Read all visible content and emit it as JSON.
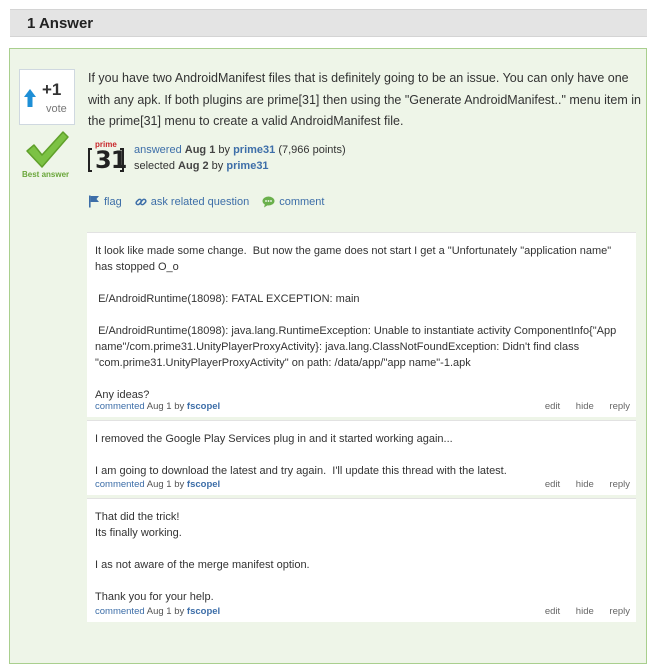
{
  "header": {
    "title": "1 Answer"
  },
  "answer": {
    "vote": {
      "count": "+1",
      "label": "vote"
    },
    "best_answer_label": "Best answer",
    "text": "If you have two AndroidManifest files that is definitely going to be an issue. You can only have one with any apk. If both plugins are prime[31] then using the \"Generate AndroidManifest..\" menu item in the prime[31] menu to create a valid AndroidManifest file.",
    "avatar": {
      "top": "prime",
      "number": "31"
    },
    "answered": {
      "label": "answered",
      "date": "Aug 1",
      "by": "by",
      "user": "prime31",
      "points": "(7,966 points)"
    },
    "selected": {
      "label": "selected",
      "date": "Aug 2",
      "by": "by",
      "user": "prime31"
    },
    "actions": {
      "flag": "flag",
      "ask_related": "ask related question",
      "comment": "comment"
    }
  },
  "comments": [
    {
      "text": "It look like made some change.  But now the game does not start I get a \"Unfortunately \"application name\" has stopped O_o\n\n E/AndroidRuntime(18098): FATAL EXCEPTION: main\n\n E/AndroidRuntime(18098): java.lang.RuntimeException: Unable to instantiate activity ComponentInfo{\"App name\"/com.prime31.UnityPlayerProxyActivity}: java.lang.ClassNotFoundException: Didn't find class \"com.prime31.UnityPlayerProxyActivity\" on path: /data/app/\"app name\"-1.apk\n\nAny ideas?",
      "commented": "commented",
      "date": "Aug 1",
      "by": "by",
      "user": "fscopel",
      "edit": "edit",
      "hide": "hide",
      "reply": "reply"
    },
    {
      "text": "I removed the Google Play Services plug in and it started working again...\n\nI am going to download the latest and try again.  I'll update this thread with the latest.",
      "commented": "commented",
      "date": "Aug 1",
      "by": "by",
      "user": "fscopel",
      "edit": "edit",
      "hide": "hide",
      "reply": "reply"
    },
    {
      "text": "That did the trick!\nIts finally working.\n\nI as not aware of the merge manifest option.\n\nThank you for your help.",
      "commented": "commented",
      "date": "Aug 1",
      "by": "by",
      "user": "fscopel",
      "edit": "edit",
      "hide": "hide",
      "reply": "reply"
    }
  ],
  "colors": {
    "link": "#3d6ea8",
    "accepted_bg": "#eef5e8",
    "accepted_border": "#a9cf8e",
    "check": "#7cc244",
    "vote_arrow": "#1e8fd6",
    "logo_red": "#c8262a"
  },
  "icons": {
    "vote_up": "arrow-up-icon",
    "best": "checkmark-icon",
    "flag": "flag-icon",
    "ask": "link-icon",
    "comment": "speech-bubble-icon"
  }
}
